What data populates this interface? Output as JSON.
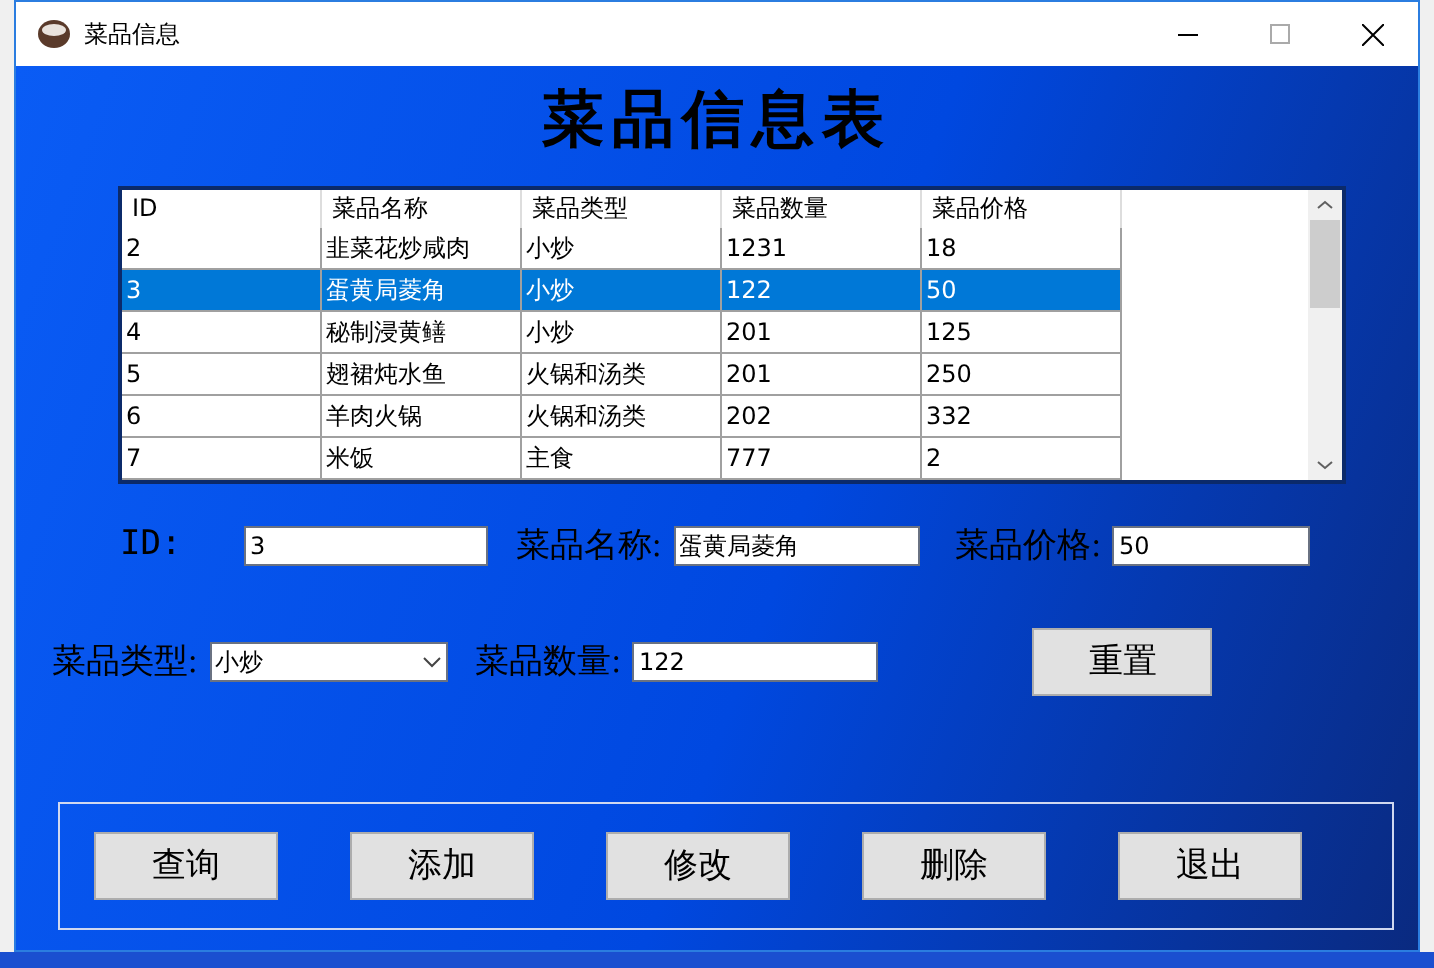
{
  "window": {
    "title": "菜品信息"
  },
  "heading": "菜品信息表",
  "table": {
    "columns": [
      "ID",
      "菜品名称",
      "菜品类型",
      "菜品数量",
      "菜品价格"
    ],
    "rows": [
      {
        "cells": [
          "2",
          "韭菜花炒咸肉",
          "小炒",
          "1231",
          "18"
        ],
        "selected": false
      },
      {
        "cells": [
          "3",
          "蛋黄局菱角",
          "小炒",
          "122",
          "50"
        ],
        "selected": true
      },
      {
        "cells": [
          "4",
          "秘制浸黄鳝",
          "小炒",
          "201",
          "125"
        ],
        "selected": false
      },
      {
        "cells": [
          "5",
          "翅裙炖水鱼",
          "火锅和汤类",
          "201",
          "250"
        ],
        "selected": false
      },
      {
        "cells": [
          "6",
          "羊肉火锅",
          "火锅和汤类",
          "202",
          "332"
        ],
        "selected": false
      },
      {
        "cells": [
          "7",
          "米饭",
          "主食",
          "777",
          "2"
        ],
        "selected": false
      }
    ]
  },
  "form": {
    "id": {
      "label": "ID:",
      "value": "3"
    },
    "name": {
      "label": "菜品名称:",
      "value": "蛋黄局菱角"
    },
    "price": {
      "label": "菜品价格:",
      "value": "50"
    },
    "type": {
      "label": "菜品类型:",
      "value": "小炒"
    },
    "quantity": {
      "label": "菜品数量:",
      "value": "122"
    },
    "reset": "重置"
  },
  "buttons": [
    "查询",
    "添加",
    "修改",
    "删除",
    "退出"
  ]
}
